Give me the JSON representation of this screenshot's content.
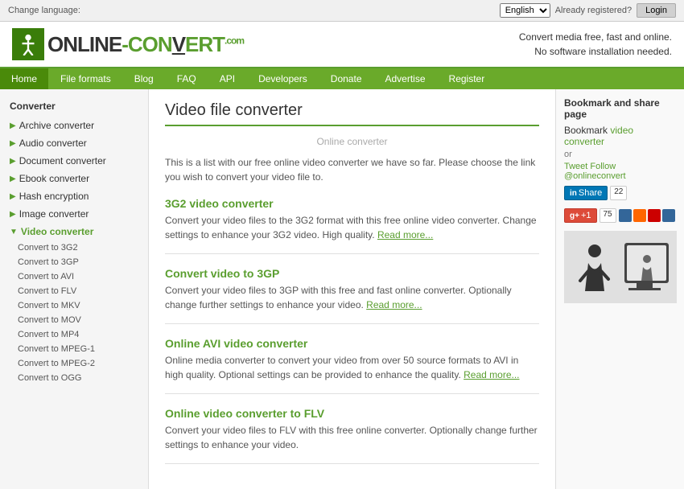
{
  "topbar": {
    "change_language_label": "Change language:",
    "language_value": "English",
    "already_registered": "Already registered?",
    "login_button": "Login"
  },
  "header": {
    "logo_text_part1": "ONLINE",
    "logo_text_dash": "-",
    "logo_text_part2": "CONVERT",
    "logo_com": ".com",
    "tagline_line1": "Convert media free, fast and online.",
    "tagline_line2": "No software installation needed."
  },
  "nav": {
    "items": [
      {
        "label": "Home",
        "active": true
      },
      {
        "label": "File formats",
        "active": false
      },
      {
        "label": "Blog",
        "active": false
      },
      {
        "label": "FAQ",
        "active": false
      },
      {
        "label": "API",
        "active": false
      },
      {
        "label": "Developers",
        "active": false
      },
      {
        "label": "Donate",
        "active": false
      },
      {
        "label": "Advertise",
        "active": false
      },
      {
        "label": "Register",
        "active": false
      }
    ]
  },
  "sidebar": {
    "title": "Converter",
    "categories": [
      {
        "label": "Archive converter",
        "open": false,
        "subitems": []
      },
      {
        "label": "Audio converter",
        "open": false,
        "subitems": []
      },
      {
        "label": "Document converter",
        "open": false,
        "subitems": []
      },
      {
        "label": "Ebook converter",
        "open": false,
        "subitems": []
      },
      {
        "label": "Hash encryption",
        "open": false,
        "subitems": []
      },
      {
        "label": "Image converter",
        "open": false,
        "subitems": []
      },
      {
        "label": "Video converter",
        "open": true,
        "subitems": [
          "Convert to 3G2",
          "Convert to 3GP",
          "Convert to AVI",
          "Convert to FLV",
          "Convert to MKV",
          "Convert to MOV",
          "Convert to MP4",
          "Convert to MPEG-1",
          "Convert to MPEG-2",
          "Convert to OGG"
        ]
      }
    ]
  },
  "content": {
    "page_title": "Video file converter",
    "online_converter_label": "Online converter",
    "intro_text": "This is a list with our free online video converter we have so far. Please choose the link you wish to convert your video file to.",
    "converters": [
      {
        "title": "3G2 video converter",
        "description": "Convert your video files to the 3G2 format with this free online video converter. Change settings to enhance your 3G2 video. High quality.",
        "read_more": "Read more..."
      },
      {
        "title": "Convert video to 3GP",
        "description": "Convert your video files to 3GP with this free and fast online converter. Optionally change further settings to enhance your video.",
        "read_more": "Read more..."
      },
      {
        "title": "Online AVI video converter",
        "description": "Online media converter to convert your video from over 50 source formats to AVI in high quality. Optional settings can be provided to enhance the quality.",
        "read_more": "Read more..."
      },
      {
        "title": "Online video converter to FLV",
        "description": "Convert your video files to FLV with this free online converter. Optionally change further settings to enhance your video.",
        "read_more": "Read more..."
      }
    ]
  },
  "right_panel": {
    "bookmark_title": "Bookmark and share page",
    "bookmark_text": "Bookmark",
    "bookmark_link": "video converter",
    "or_text": "or",
    "tweet_text": "Tweet Follow",
    "tweet_handle": "@onlineconvert",
    "linkedin_label": "Share",
    "linkedin_count": "22",
    "gplus_label": "+1",
    "gplus_count": "75"
  }
}
